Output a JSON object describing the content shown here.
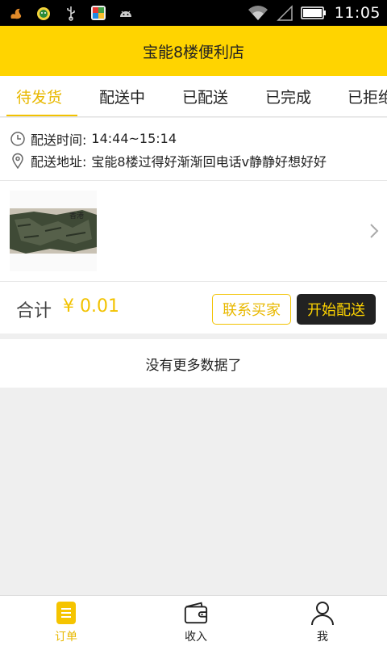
{
  "status_bar": {
    "time": "11:05",
    "icons": [
      "squirrel-icon",
      "cat-face-icon",
      "usb-icon",
      "colorful-app-icon",
      "android-icon",
      "wifi-icon",
      "signal-icon",
      "battery-icon"
    ]
  },
  "header": {
    "title": "宝能8楼便利店"
  },
  "tabs": [
    {
      "label": "待发货"
    },
    {
      "label": "配送中"
    },
    {
      "label": "已配送"
    },
    {
      "label": "已完成"
    },
    {
      "label": "已拒绝"
    }
  ],
  "order": {
    "time_label": "配送时间:",
    "time_value": "14:44~15:14",
    "address_label": "配送地址:",
    "address_value": "宝能8楼过得好渐渐回电话v静静好想好好",
    "total_label": "合计",
    "total_amount": "¥ 0.01",
    "contact_button": "联系买家",
    "start_button": "开始配送"
  },
  "no_more": "没有更多数据了",
  "bottom_nav": [
    {
      "label": "订单"
    },
    {
      "label": "收入"
    },
    {
      "label": "我"
    }
  ],
  "colors": {
    "brand_yellow": "#ffd400",
    "accent_text": "#e8b800",
    "dark_button": "#222222"
  }
}
